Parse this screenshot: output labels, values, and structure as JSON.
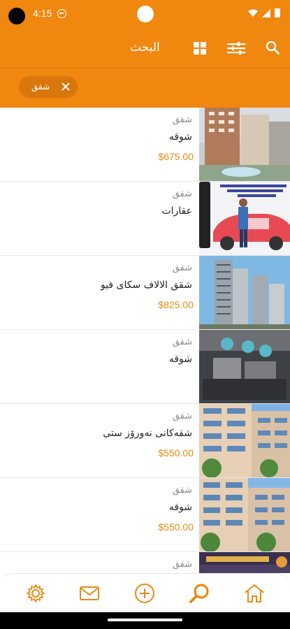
{
  "status_bar": {
    "time": "4:15"
  },
  "app_bar": {
    "title": "البحث",
    "icons": [
      "grid-view-icon",
      "filter-sliders-icon",
      "search-icon"
    ]
  },
  "filter_chip": {
    "label": "شقق",
    "icon": "close-icon"
  },
  "colors": {
    "primary": "#f0870f",
    "chip": "#d9760c",
    "price": "#e88a12"
  },
  "listings": [
    {
      "category": "شقق",
      "name": "شوقە",
      "price": "$675.00"
    },
    {
      "category": "شقق",
      "name": "عقارات",
      "price": ""
    },
    {
      "category": "شقق",
      "name": "شقق الالاف سكاى فيو",
      "price": "$825.00"
    },
    {
      "category": "شقق",
      "name": "شوقە",
      "price": ""
    },
    {
      "category": "شقق",
      "name": "شقەکانی نەورۆز ستی",
      "price": "$550.00"
    },
    {
      "category": "شقق",
      "name": "شوقە",
      "price": "$550.00"
    },
    {
      "category": "شقق",
      "name": "",
      "price": ""
    }
  ],
  "bottom_nav": [
    "settings-icon",
    "mail-icon",
    "add-icon",
    "search-icon",
    "home-icon"
  ]
}
